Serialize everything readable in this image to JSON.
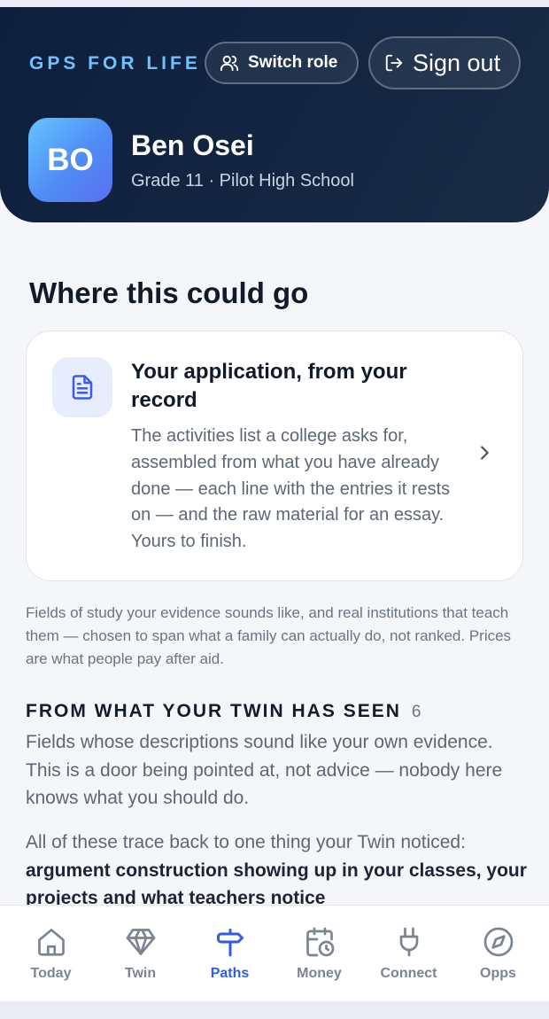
{
  "header": {
    "brand": "GPS FOR LIFE",
    "switch_role_label": "Switch role",
    "sign_out_label": "Sign out",
    "avatar_initials": "BO",
    "user_name": "Ben Osei",
    "user_meta": "Grade 11 · Pilot High School"
  },
  "main": {
    "section_title": "Where this could go",
    "card": {
      "icon": "document-icon",
      "title": "Your application, from your record",
      "body": "The activities list a college asks for, assembled from what you have already done — each line with the entries it rests on — and the raw material for an essay. Yours to finish."
    },
    "note": "Fields of study your evidence sounds like, and real institutions that teach them — chosen to span what a family can actually do, not ranked. Prices are what people pay after aid.",
    "subhead": "FROM WHAT YOUR TWIN HAS SEEN",
    "subhead_count": "6",
    "para1": "Fields whose descriptions sound like your own evidence. This is a door being pointed at, not advice — nobody here knows what you should do.",
    "para2_lead": "All of these trace back to one thing your Twin noticed: ",
    "para2_bold": "argument construction showing up in your classes, your projects and what teachers notice"
  },
  "tabs": [
    {
      "label": "Today",
      "icon": "home-icon",
      "active": false
    },
    {
      "label": "Twin",
      "icon": "diamond-icon",
      "active": false
    },
    {
      "label": "Paths",
      "icon": "signpost-icon",
      "active": true
    },
    {
      "label": "Money",
      "icon": "calendar-clock-icon",
      "active": false
    },
    {
      "label": "Connect",
      "icon": "plug-icon",
      "active": false
    },
    {
      "label": "Opps",
      "icon": "compass-icon",
      "active": false
    }
  ],
  "colors": {
    "header_bg": "#0d1f3c",
    "brand": "#6ec1ff",
    "accent": "#2e5be8",
    "muted": "#7b8493"
  }
}
